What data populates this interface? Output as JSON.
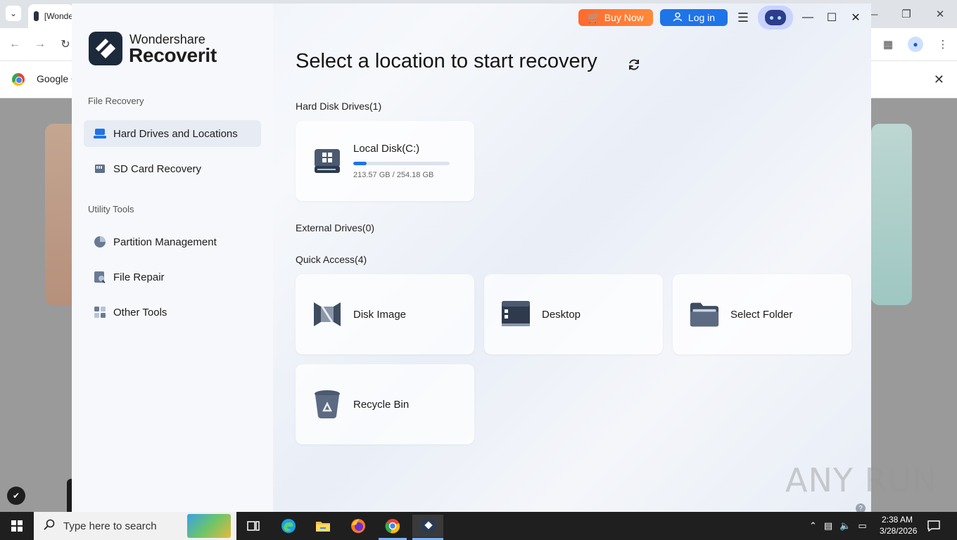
{
  "browser": {
    "tab_title": "[Wonde",
    "infobar_text": "Google C"
  },
  "app": {
    "brand_top": "Wondershare",
    "brand_main": "Recoverit",
    "buy_now_label": "Buy Now",
    "login_label": "Log in",
    "sidebar": {
      "file_recovery_label": "File Recovery",
      "utility_tools_label": "Utility Tools",
      "items": [
        {
          "label": "Hard Drives and Locations",
          "icon": "drive-icon"
        },
        {
          "label": "SD Card Recovery",
          "icon": "sd-card-icon"
        },
        {
          "label": "Partition Management",
          "icon": "pie-chart-icon"
        },
        {
          "label": "File Repair",
          "icon": "file-repair-icon"
        },
        {
          "label": "Other Tools",
          "icon": "tools-grid-icon"
        }
      ]
    },
    "main": {
      "title": "Select a location to start recovery",
      "hard_disk_label": "Hard Disk Drives(1)",
      "external_label": "External Drives(0)",
      "quick_access_label": "Quick Access(4)",
      "local_disk": {
        "name": "Local Disk(C:)",
        "size_text": "213.57 GB / 254.18 GB",
        "used_fraction": 0.14
      },
      "quick_access": [
        {
          "label": "Disk Image",
          "icon": "disk-image-icon"
        },
        {
          "label": "Desktop",
          "icon": "desktop-icon"
        },
        {
          "label": "Select Folder",
          "icon": "folder-icon"
        },
        {
          "label": "Recycle Bin",
          "icon": "recycle-bin-icon"
        }
      ]
    }
  },
  "watermark": "ANY RUN",
  "taskbar": {
    "search_placeholder": "Type here to search",
    "time": "2:38 AM",
    "date": "3/28/2026"
  },
  "colors": {
    "accent": "#1f74e8",
    "buy": "#ff7a33"
  }
}
